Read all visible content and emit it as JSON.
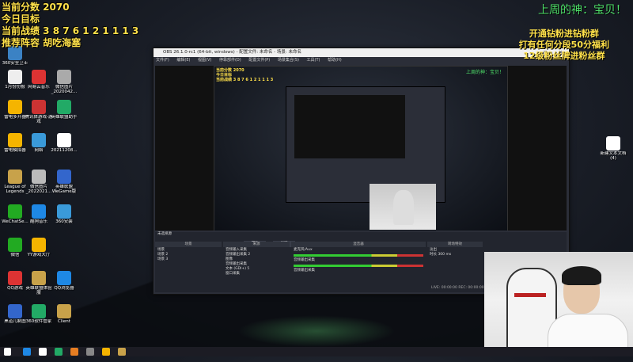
{
  "overlay_left": {
    "score": "当前分数 2070",
    "goal": "今日目标",
    "record": "当前战绩 3 8 7 6 1 2 1 1 1 3",
    "recommend": "推荐阵容 胡吃海塞"
  },
  "overlay_right": {
    "title": "上周的神：宝贝！",
    "line1": "开通钻粉进钻粉群",
    "line2": "打有任何分段50分福利",
    "line3": "12级粉丝牌进粉丝群"
  },
  "desktop": {
    "icons": [
      {
        "label": "360安全卫士",
        "color": "#3b82c4"
      },
      {
        "label": "1月份份报",
        "color": "#eeeeee"
      },
      {
        "label": "网易云音乐",
        "color": "#d33"
      },
      {
        "label": "微信图片_2020042...",
        "color": "#aaaaaa"
      },
      {
        "label": "雷电多开器",
        "color": "#f5b400"
      },
      {
        "label": "腾讯体游戏-游戏",
        "color": "#c33"
      },
      {
        "label": "英雄联盟助手",
        "color": "#2a6"
      },
      {
        "label": "雷电模拟器",
        "color": "#f5b400"
      },
      {
        "label": "网络",
        "color": "#3a9ad9"
      },
      {
        "label": "20211208...",
        "color": "#ffffff"
      },
      {
        "label": "League of Legends",
        "color": "#c8a24a"
      },
      {
        "label": "微信图片_2022021...",
        "color": "#bbbbbb"
      },
      {
        "label": "英雄联盟 WeGame版",
        "color": "#3366cc"
      },
      {
        "label": "WeChatSe...",
        "color": "#2a2"
      },
      {
        "label": "酷狗音乐",
        "color": "#1e88e5"
      },
      {
        "label": "360安装",
        "color": "#3a9ad9"
      },
      {
        "label": "微信",
        "color": "#2a2"
      },
      {
        "label": "YY游戏大厅",
        "color": "#f5b400"
      },
      {
        "label": "QQ游戏",
        "color": "#d33"
      },
      {
        "label": "英雄联盟体验服",
        "color": "#c8a24a"
      },
      {
        "label": "QQ浏览器",
        "color": "#1e88e5"
      },
      {
        "label": "黑道儿制图",
        "color": "#3366cc"
      },
      {
        "label": "360软件管家",
        "color": "#2a6"
      },
      {
        "label": "Client",
        "color": "#c8a24a"
      },
      {
        "label": "新建文本文档 (4)",
        "color": "#ffffff"
      }
    ]
  },
  "obs": {
    "title": "OBS 26.1.0-rc1 (64-bit, windows) - 配置文件: 未命名 - 场景: 未命名",
    "menu": [
      "文件(F)",
      "编辑(E)",
      "视图(V)",
      "停靠部件(D)",
      "配置文件(P)",
      "场景集合(S)",
      "工具(T)",
      "帮助(H)"
    ],
    "dock": {
      "no_source": "未选择源",
      "properties": "属性",
      "filters": "滤镜",
      "scenes_header": "场景",
      "scenes": [
        "场景",
        "场景 2",
        "场景 3"
      ],
      "sources_header": "来源",
      "sources": [
        "音频输入采集",
        "音频输出采集 2",
        "图像",
        "音频输出采集",
        "文本 (GDI+) 5",
        "窗口采集"
      ],
      "mixer_header": "混音器",
      "mixer": [
        "麦克风/Aux",
        "音频输出采集",
        "音频输出采集"
      ],
      "transitions_header": "转场特效",
      "transition_value": "淡出",
      "duration_label": "时长",
      "duration_value": "300 ms",
      "status": "LIVE: 00:00:00  REC: 00:00:00  CPU: 2.2%, 30.00 fps"
    }
  },
  "taskbar": {
    "colors": [
      "#1e88e5",
      "#ffffff",
      "#2a6",
      "#e67e22",
      "#888888",
      "#f5b400",
      "#c8a24a"
    ]
  }
}
